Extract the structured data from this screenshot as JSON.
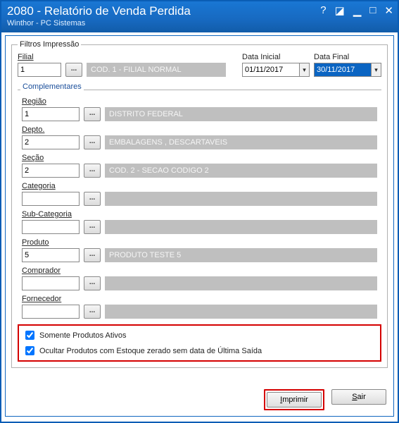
{
  "window": {
    "title": "2080 - Relatório de Venda Perdida",
    "subtitle": "Winthor - PC Sistemas"
  },
  "filters": {
    "legend": "Filtros Impressão",
    "filial": {
      "label": "Filial",
      "value": "1",
      "desc": "COD. 1 - FILIAL NORMAL"
    },
    "dataInicial": {
      "label": "Data Inicial",
      "value": "01/11/2017"
    },
    "dataFinal": {
      "label": "Data Final",
      "value": "30/11/2017"
    }
  },
  "complementares": {
    "legend": "Complementares",
    "regiao": {
      "label": "Região",
      "value": "1",
      "desc": "DISTRITO FEDERAL"
    },
    "depto": {
      "label": "Depto.",
      "value": "2",
      "desc": "EMBALAGENS , DESCARTAVEIS"
    },
    "secao": {
      "label": "Seção",
      "value": "2",
      "desc": "COD. 2 - SECAO CODIGO 2"
    },
    "categoria": {
      "label": "Categoria",
      "value": "",
      "desc": ""
    },
    "subcategoria": {
      "label": "Sub-Categoria",
      "value": "",
      "desc": ""
    },
    "produto": {
      "label": "Produto",
      "value": "5",
      "desc": "PRODUTO TESTE 5"
    },
    "comprador": {
      "label": "Comprador",
      "value": "",
      "desc": ""
    },
    "fornecedor": {
      "label": "Fornecedor",
      "value": "",
      "desc": ""
    }
  },
  "checks": {
    "ativos": "Somente Produtos Ativos",
    "ocultar": "Ocultar Produtos com Estoque zerado sem data de Última Saída"
  },
  "buttons": {
    "imprimir_pre": "I",
    "imprimir_post": "mprimir",
    "sair_pre": "S",
    "sair_post": "air"
  },
  "lookup_label": "..."
}
